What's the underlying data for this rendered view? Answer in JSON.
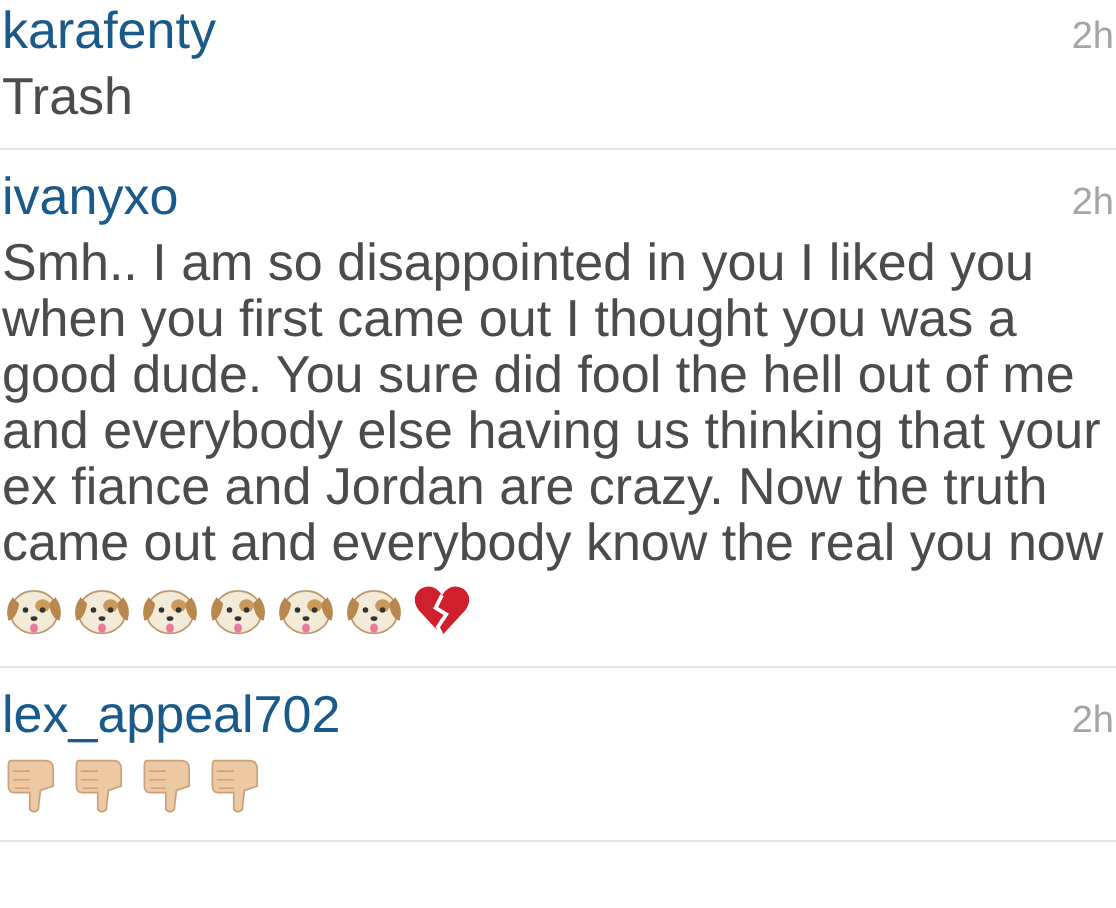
{
  "comments": [
    {
      "username": "karafenty",
      "time": "2h",
      "text": "Trash"
    },
    {
      "username": "ivanyxo",
      "time": "2h",
      "text": "Smh.. I am so disappointed in you I liked you when you first came out I thought you was a good dude. You sure did fool the hell out of me and everybody else having us thinking that your ex fiance and Jordan are crazy. Now the truth came out and everybody know the real you now",
      "emoji": [
        {
          "kind": "dog"
        },
        {
          "kind": "dog"
        },
        {
          "kind": "dog"
        },
        {
          "kind": "dog"
        },
        {
          "kind": "dog"
        },
        {
          "kind": "dog"
        },
        {
          "kind": "broken_heart"
        }
      ]
    },
    {
      "username": "lex_appeal702",
      "time": "2h",
      "emoji": [
        {
          "kind": "thumbs_down"
        },
        {
          "kind": "thumbs_down"
        },
        {
          "kind": "thumbs_down"
        },
        {
          "kind": "thumbs_down"
        }
      ]
    }
  ]
}
